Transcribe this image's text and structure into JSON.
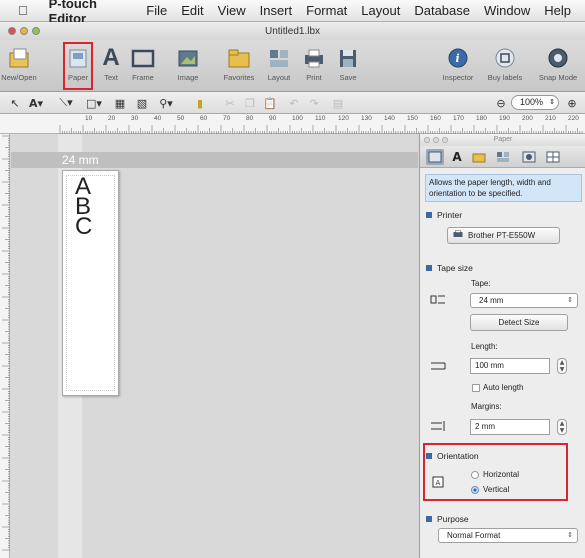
{
  "menubar": {
    "app_name": "P-touch Editor",
    "items": [
      "File",
      "Edit",
      "View",
      "Insert",
      "Format",
      "Layout",
      "Database",
      "Window",
      "Help"
    ]
  },
  "window": {
    "title": "Untitled1.lbx"
  },
  "toolbar": {
    "buttons": [
      {
        "label": "New/Open",
        "icon": "new-open-icon"
      },
      {
        "label": "Paper",
        "icon": "paper-icon"
      },
      {
        "label": "Text",
        "icon": "text-icon"
      },
      {
        "label": "Frame",
        "icon": "frame-icon"
      },
      {
        "label": "Image",
        "icon": "image-icon"
      },
      {
        "label": "Favorites",
        "icon": "favorites-icon"
      },
      {
        "label": "Layout",
        "icon": "layout-icon"
      },
      {
        "label": "Print",
        "icon": "print-icon"
      },
      {
        "label": "Save",
        "icon": "save-icon"
      },
      {
        "label": "Inspector",
        "icon": "inspector-icon"
      },
      {
        "label": "Buy labels",
        "icon": "buy-labels-icon"
      },
      {
        "label": "Snap Mode",
        "icon": "snap-mode-icon"
      }
    ],
    "highlighted": "Paper"
  },
  "formatbar": {
    "zoom": "100%"
  },
  "ruler": {
    "ticks": [
      "10",
      "20",
      "30",
      "40",
      "50",
      "60",
      "70",
      "80",
      "90",
      "100",
      "110",
      "120",
      "130",
      "140",
      "150",
      "160",
      "170",
      "180",
      "190",
      "200",
      "210",
      "220"
    ]
  },
  "canvas": {
    "tape_label": "24 mm",
    "label_text": "A\nB\nC"
  },
  "panel": {
    "title": "Paper",
    "description": "Allows the paper length, width and orientation to be specified.",
    "printer": {
      "heading": "Printer",
      "device": "Brother PT-E550W"
    },
    "tape_size": {
      "heading": "Tape size",
      "tape_label": "Tape:",
      "tape_value": "24 mm",
      "detect_button": "Detect Size",
      "length_label": "Length:",
      "length_value": "100 mm",
      "auto_length": "Auto length",
      "margins_label": "Margins:",
      "margins_value": "2 mm"
    },
    "orientation": {
      "heading": "Orientation",
      "options": [
        "Horizontal",
        "Vertical"
      ],
      "selected": "Vertical"
    },
    "purpose": {
      "heading": "Purpose",
      "value": "Normal Format"
    }
  },
  "colors": {
    "highlight": "#d7262e",
    "accent": "#3d6aa6"
  }
}
